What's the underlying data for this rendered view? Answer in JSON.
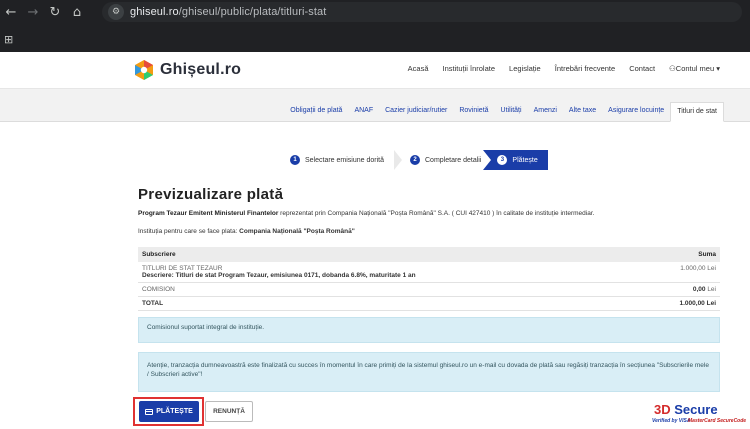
{
  "browser": {
    "url_host": "ghiseul.ro",
    "url_path": "/ghiseul/public/plata/titluri-stat",
    "back_icon": "arrow-left-icon",
    "forward_icon": "arrow-right-icon",
    "reload_icon": "reload-icon",
    "home_icon": "home-icon"
  },
  "header": {
    "logo_text": "Ghișeul.ro",
    "nav": [
      "Acasă",
      "Instituții înrolate",
      "Legislație",
      "Întrebări frecvente",
      "Contact",
      "Contul meu"
    ]
  },
  "subnav": {
    "items": [
      "Obligații de plată",
      "ANAF",
      "Cazier judiciar/rutier",
      "Rovinietă",
      "Utilități",
      "Amenzi",
      "Alte taxe",
      "Asigurare locuințe",
      "Titluri de stat"
    ],
    "active_index": 8
  },
  "steps": [
    {
      "num": "1",
      "label": "Selectare emisiune dorită"
    },
    {
      "num": "2",
      "label": "Completare detalii"
    },
    {
      "num": "3",
      "label": "Plătește"
    }
  ],
  "content": {
    "title": "Previzualizare plată",
    "program_bold": "Program Tezaur Emitent Ministerul Finantelor",
    "program_rest": " reprezentat prin Compania Națională \"Poșta Română\" S.A. ( CUI 427410 ) în calitate de instituție intermediar.",
    "institution_label": "Instituția pentru care se face plata: ",
    "institution_value": "Compania Națională \"Poșta Română\""
  },
  "table": {
    "col_subscriere": "Subscriere",
    "col_suma": "Suma",
    "row1_title": "TITLURI DE STAT TEZAUR",
    "row1_desc": "Descriere: Titluri de stat Program Tezaur, emisiunea 0171, dobanda 6.8%, maturitate 1 an",
    "row1_amount": "1.000,00 Lei",
    "row2_label": "COMISION",
    "row2_amount_bold": "0,00",
    "row2_amount_unit": " Lei",
    "row3_label": "TOTAL",
    "row3_amount": "1.000,00 Lei"
  },
  "info": {
    "commission_note": "Comisionul suportat integral de instituție.",
    "attention_note": "Atenție, tranzacția dumneavoastră este finalizată cu succes în momentul în care primiți de la sistemul ghiseul.ro un e-mail cu dovada de plată sau regăsiți tranzacția în secțiunea \"Subscrierile mele / Subscrieri active\"!"
  },
  "buttons": {
    "pay": "PLĂTEȘTE",
    "cancel": "RENUNȚĂ"
  },
  "secure": {
    "three": "3D",
    "secure": " Secure",
    "verified": "Verified by VISA",
    "mastercard": "MasterCard SecureCode"
  },
  "colors": {
    "brand_blue": "#1a3da8",
    "highlight_red": "#e03232",
    "info_bg": "#d9eef6"
  }
}
